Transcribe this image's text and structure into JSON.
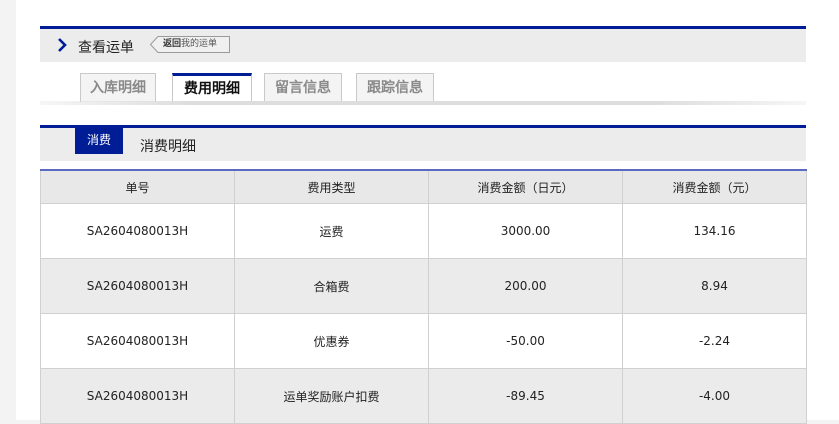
{
  "header": {
    "title": "查看运单",
    "back_bold": "返回",
    "back_rest": "我的运单"
  },
  "tabs": [
    {
      "label": "入库明细",
      "active": false
    },
    {
      "label": "费用明细",
      "active": true
    },
    {
      "label": "留言信息",
      "active": false
    },
    {
      "label": "跟踪信息",
      "active": false
    }
  ],
  "section": {
    "badge": "消费",
    "title": "消费明细"
  },
  "table": {
    "headers": [
      "单号",
      "费用类型",
      "消费金额（日元）",
      "消费金额（元）"
    ],
    "rows": [
      [
        "SA2604080013H",
        "运费",
        "3000.00",
        "134.16"
      ],
      [
        "SA2604080013H",
        "合箱费",
        "200.00",
        "8.94"
      ],
      [
        "SA2604080013H",
        "优惠券",
        "-50.00",
        "-2.24"
      ],
      [
        "SA2604080013H",
        "运单奖励账户扣费",
        "-89.45",
        "-4.00"
      ]
    ]
  },
  "colors": {
    "accent": "#001d96",
    "header_bg": "#ececec",
    "row_alt": "#ebebeb"
  }
}
